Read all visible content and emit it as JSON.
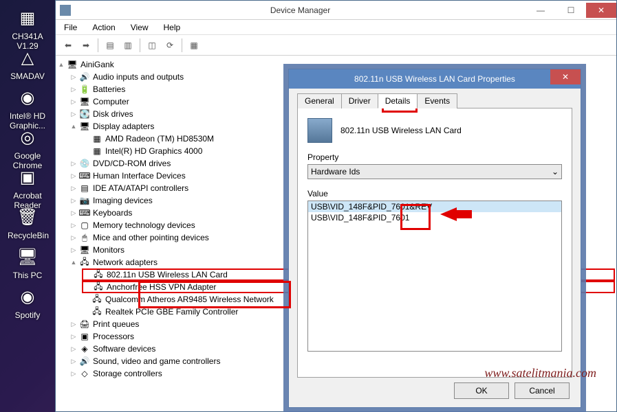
{
  "desktop": [
    {
      "label": "CH341A V1.29",
      "glyph": "▦"
    },
    {
      "label": "SMADAV",
      "glyph": "△"
    },
    {
      "label": "Intel® HD Graphic...",
      "glyph": "◉"
    },
    {
      "label": "Google Chrome",
      "glyph": "◎"
    },
    {
      "label": "Acrobat Reader DC",
      "glyph": "▣"
    },
    {
      "label": "RecycleBin",
      "glyph": "🗑"
    },
    {
      "label": "This PC",
      "glyph": "🖥"
    },
    {
      "label": "Spotify",
      "glyph": "◉"
    }
  ],
  "window": {
    "title": "Device Manager",
    "menu": [
      "File",
      "Action",
      "View",
      "Help"
    ],
    "winbtns": {
      "min": "—",
      "max": "☐",
      "close": "✕"
    }
  },
  "toolbar": [
    {
      "name": "back-icon",
      "glyph": "⬅"
    },
    {
      "name": "forward-icon",
      "glyph": "➡"
    },
    {
      "sep": true
    },
    {
      "name": "show-hidden-icon",
      "glyph": "▤"
    },
    {
      "name": "devices-printers-icon",
      "glyph": "▥"
    },
    {
      "sep": true
    },
    {
      "name": "properties-icon",
      "glyph": "◫"
    },
    {
      "name": "update-driver-icon",
      "glyph": "⟳"
    },
    {
      "sep": true
    },
    {
      "name": "uninstall-icon",
      "glyph": "▦"
    }
  ],
  "tree": {
    "root": "AiniGank",
    "items": [
      {
        "label": "Audio inputs and outputs",
        "icon": "🔊",
        "exp": "▷"
      },
      {
        "label": "Batteries",
        "icon": "🔋",
        "exp": "▷"
      },
      {
        "label": "Computer",
        "icon": "🖥",
        "exp": "▷"
      },
      {
        "label": "Disk drives",
        "icon": "💽",
        "exp": "▷"
      },
      {
        "label": "Display adapters",
        "icon": "🖥",
        "exp": "▲",
        "children": [
          {
            "label": "AMD Radeon (TM) HD8530M",
            "icon": "▦"
          },
          {
            "label": "Intel(R) HD Graphics 4000",
            "icon": "▦"
          }
        ]
      },
      {
        "label": "DVD/CD-ROM drives",
        "icon": "💿",
        "exp": "▷"
      },
      {
        "label": "Human Interface Devices",
        "icon": "⌨",
        "exp": "▷"
      },
      {
        "label": "IDE ATA/ATAPI controllers",
        "icon": "▤",
        "exp": "▷"
      },
      {
        "label": "Imaging devices",
        "icon": "📷",
        "exp": "▷"
      },
      {
        "label": "Keyboards",
        "icon": "⌨",
        "exp": "▷"
      },
      {
        "label": "Memory technology devices",
        "icon": "▢",
        "exp": "▷"
      },
      {
        "label": "Mice and other pointing devices",
        "icon": "🖱",
        "exp": "▷"
      },
      {
        "label": "Monitors",
        "icon": "🖥",
        "exp": "▷"
      },
      {
        "label": "Network adapters",
        "icon": "🖧",
        "exp": "▲",
        "children": [
          {
            "label": "802.11n USB Wireless LAN Card",
            "icon": "🖧",
            "hl": true
          },
          {
            "label": "Anchorfree HSS VPN Adapter",
            "icon": "🖧",
            "hl": true
          },
          {
            "label": "Qualcomm Atheros AR9485 Wireless Network",
            "icon": "🖧"
          },
          {
            "label": "Realtek PCIe GBE Family Controller",
            "icon": "🖧"
          }
        ]
      },
      {
        "label": "Print queues",
        "icon": "🖨",
        "exp": "▷"
      },
      {
        "label": "Processors",
        "icon": "▣",
        "exp": "▷"
      },
      {
        "label": "Software devices",
        "icon": "◈",
        "exp": "▷"
      },
      {
        "label": "Sound, video and game controllers",
        "icon": "🔊",
        "exp": "▷"
      },
      {
        "label": "Storage controllers",
        "icon": "◇",
        "exp": "▷"
      }
    ]
  },
  "dialog": {
    "title": "802.11n USB Wireless LAN Card Properties",
    "close": "✕",
    "tabs": [
      "General",
      "Driver",
      "Details",
      "Events"
    ],
    "active_tab": "Details",
    "device_name": "802.11n USB Wireless LAN Card",
    "property_label": "Property",
    "property_value": "Hardware Ids",
    "dropdown_glyph": "⌄",
    "value_label": "Value",
    "values": [
      "USB\\VID_148F&PID_7601&REV",
      "USB\\VID_148F&PID_7601"
    ],
    "selected_value_index": 0,
    "ok": "OK",
    "cancel": "Cancel"
  },
  "watermark": "www.satelitmania.com"
}
